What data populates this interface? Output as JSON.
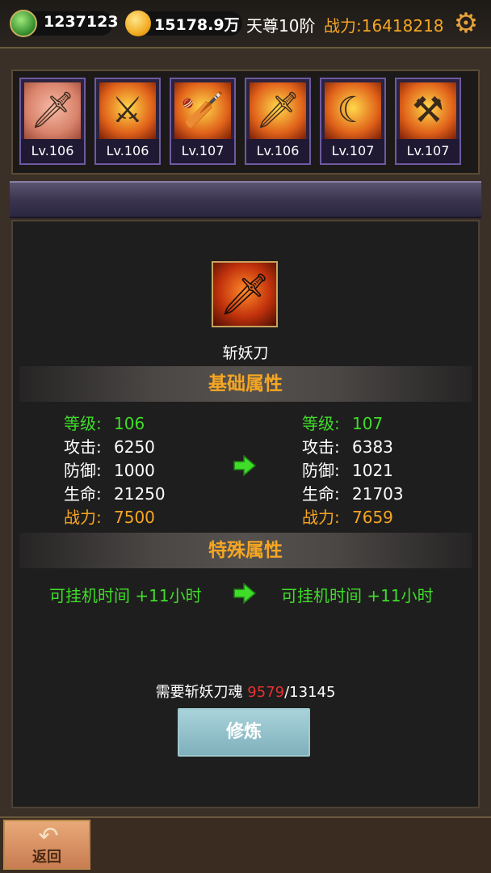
{
  "header": {
    "jade_amount": "1237123",
    "gold_amount": "15178.9万",
    "rank": "天尊10阶",
    "power_label": "战力:16418218"
  },
  "weapons": [
    {
      "level": "Lv.106",
      "selected": true
    },
    {
      "level": "Lv.106"
    },
    {
      "level": "Lv.107"
    },
    {
      "level": "Lv.106"
    },
    {
      "level": "Lv.107"
    },
    {
      "level": "Lv.107"
    }
  ],
  "detail": {
    "weapon_name": "斩妖刀",
    "basic_title": "基础属性",
    "special_title": "特殊属性",
    "current": {
      "level_label": "等级:",
      "level": "106",
      "attack_label": "攻击:",
      "attack": "6250",
      "defense_label": "防御:",
      "defense": "1000",
      "hp_label": "生命:",
      "hp": "21250",
      "power_label": "战力:",
      "power": "7500"
    },
    "next": {
      "level_label": "等级:",
      "level": "107",
      "attack_label": "攻击:",
      "attack": "6383",
      "defense_label": "防御:",
      "defense": "1021",
      "hp_label": "生命:",
      "hp": "21703",
      "power_label": "战力:",
      "power": "7659"
    },
    "special_current": "可挂机时间 +11小时",
    "special_next": "可挂机时间 +11小时",
    "requirement_prefix": "需要斩妖刀魂 ",
    "requirement_current": "9579",
    "requirement_total": "/13145",
    "train_label": "修炼"
  },
  "footer": {
    "back_label": "返回"
  },
  "colors": {
    "green": "#3fdc2a",
    "orange": "#f5a623",
    "red": "#e83030"
  }
}
